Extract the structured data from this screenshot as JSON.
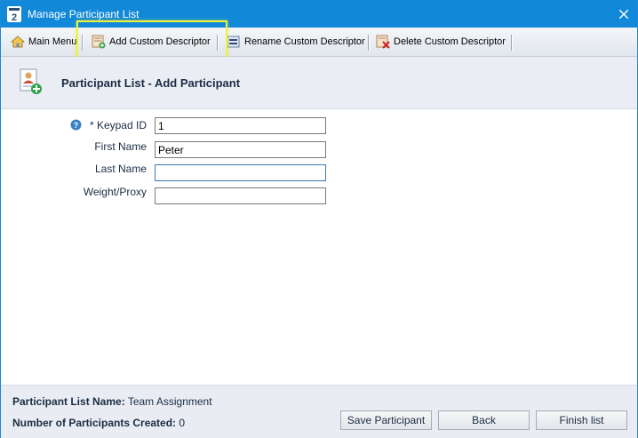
{
  "window": {
    "title": "Manage Participant List",
    "app_icon_text": "2"
  },
  "toolbar": {
    "main_menu": "Main Menu",
    "add_descriptor": "Add Custom Descriptor",
    "rename_descriptor": "Rename Custom Descriptor",
    "delete_descriptor": "Delete Custom Descriptor"
  },
  "header": {
    "title": "Participant List - Add Participant"
  },
  "form": {
    "keypad_label": "* Keypad ID",
    "keypad_value": "1",
    "first_name_label": "First Name",
    "first_name_value": "Peter",
    "last_name_label": "Last Name",
    "last_name_value": "",
    "weight_label": "Weight/Proxy",
    "weight_value": ""
  },
  "footer": {
    "list_name_label": "Participant List Name:",
    "list_name_value": "Team Assignment",
    "count_label": "Number of Participants Created:",
    "count_value": "0",
    "save_button": "Save Participant",
    "back_button": "Back",
    "finish_button": "Finish list"
  },
  "colors": {
    "titlebar": "#1289d8",
    "highlight": "#f1f53a",
    "header_bg": "#eaeef4"
  }
}
